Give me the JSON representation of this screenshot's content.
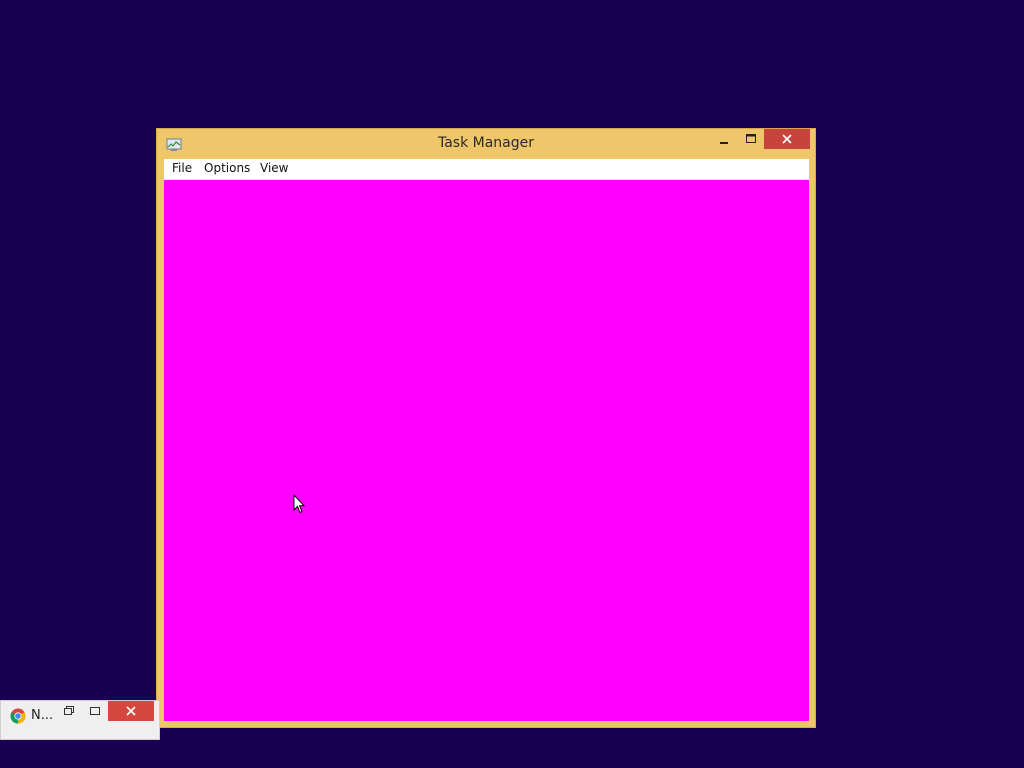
{
  "desktop": {
    "background_color": "#1a0050"
  },
  "task_manager": {
    "title": "Task Manager",
    "frame_color": "#f0c66b",
    "content_color": "#ff00ff",
    "close_button_color": "#c7443d",
    "menu": {
      "file": "File",
      "options": "Options",
      "view": "View"
    },
    "icons": {
      "app": "task-manager-icon",
      "minimize": "minimize-icon",
      "maximize": "maximize-icon",
      "close": "close-icon"
    }
  },
  "chrome_minimized": {
    "title": "N...",
    "icons": {
      "app": "chrome-icon",
      "restore": "restore-icon",
      "maximize": "maximize-icon",
      "close": "close-icon"
    }
  },
  "cursor": {
    "icon": "mouse-pointer-icon"
  }
}
